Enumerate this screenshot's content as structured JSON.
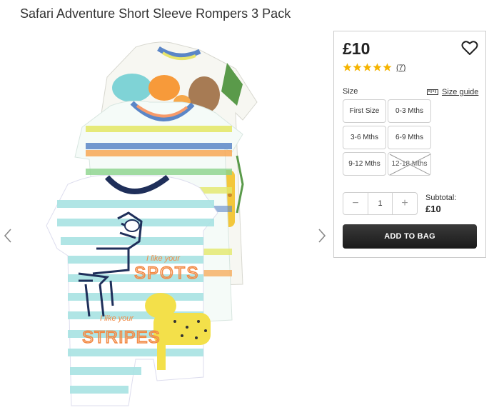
{
  "product": {
    "title": "Safari Adventure Short Sleeve Rompers 3 Pack",
    "price": "£10",
    "rating_stars": 5,
    "rating_count": "(7)"
  },
  "size_section": {
    "label": "Size",
    "guide_label": "Size guide",
    "sizes": [
      {
        "label": "First Size",
        "available": true
      },
      {
        "label": "0-3 Mths",
        "available": true
      },
      {
        "label": "3-6 Mths",
        "available": true
      },
      {
        "label": "6-9 Mths",
        "available": true
      },
      {
        "label": "9-12 Mths",
        "available": true
      },
      {
        "label": "12-18 Mths",
        "available": false
      }
    ]
  },
  "quantity": {
    "minus": "−",
    "value": "1",
    "plus": "+"
  },
  "subtotal": {
    "label": "Subtotal:",
    "value": "£10"
  },
  "add_to_bag_label": "ADD TO BAG",
  "image_text": {
    "spots_small": "I like your",
    "spots_big": "SPOTS",
    "stripes_small": "I like your",
    "stripes_big": "STRIPES"
  },
  "colors": {
    "star": "#f5b400",
    "button_bg": "#222222",
    "border": "#cccccc"
  },
  "icons": {
    "wishlist": "heart-outline-icon",
    "size_guide": "ruler-icon",
    "prev": "chevron-left-icon",
    "next": "chevron-right-icon"
  }
}
